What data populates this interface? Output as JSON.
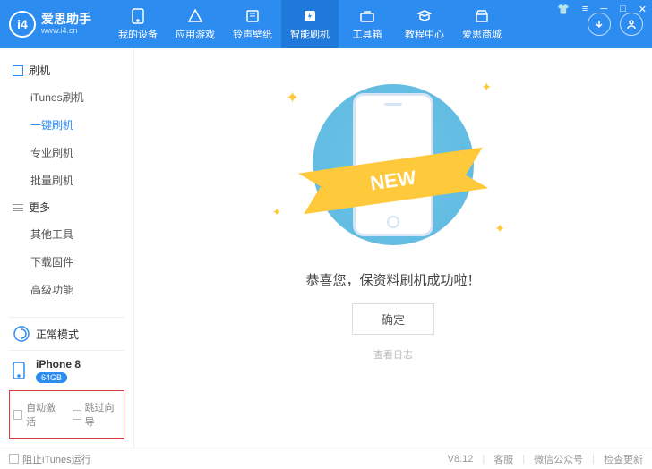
{
  "logo": {
    "brand": "爱思助手",
    "url": "www.i4.cn"
  },
  "tabs": [
    {
      "label": "我的设备",
      "icon": "phone"
    },
    {
      "label": "应用游戏",
      "icon": "app"
    },
    {
      "label": "铃声壁纸",
      "icon": "ringtone"
    },
    {
      "label": "智能刷机",
      "icon": "flash",
      "active": true
    },
    {
      "label": "工具箱",
      "icon": "toolbox"
    },
    {
      "label": "教程中心",
      "icon": "tutorial"
    },
    {
      "label": "爱思商城",
      "icon": "shop"
    }
  ],
  "sidebar": {
    "group1": {
      "title": "刷机"
    },
    "items1": [
      {
        "label": "iTunes刷机"
      },
      {
        "label": "一键刷机",
        "active": true
      },
      {
        "label": "专业刷机"
      },
      {
        "label": "批量刷机"
      }
    ],
    "group2": {
      "title": "更多"
    },
    "items2": [
      {
        "label": "其他工具"
      },
      {
        "label": "下载固件"
      },
      {
        "label": "高级功能"
      }
    ],
    "mode": {
      "label": "正常模式"
    },
    "device": {
      "name": "iPhone 8",
      "storage": "64GB"
    },
    "checks": {
      "auto_activate": "自动激活",
      "skip_guide": "跳过向导"
    }
  },
  "main": {
    "banner": "NEW",
    "message": "恭喜您，保资料刷机成功啦！",
    "confirm": "确定",
    "log_link": "查看日志"
  },
  "statusbar": {
    "block_itunes": "阻止iTunes运行",
    "version": "V8.12",
    "support": "客服",
    "wechat": "微信公众号",
    "update": "检查更新"
  }
}
